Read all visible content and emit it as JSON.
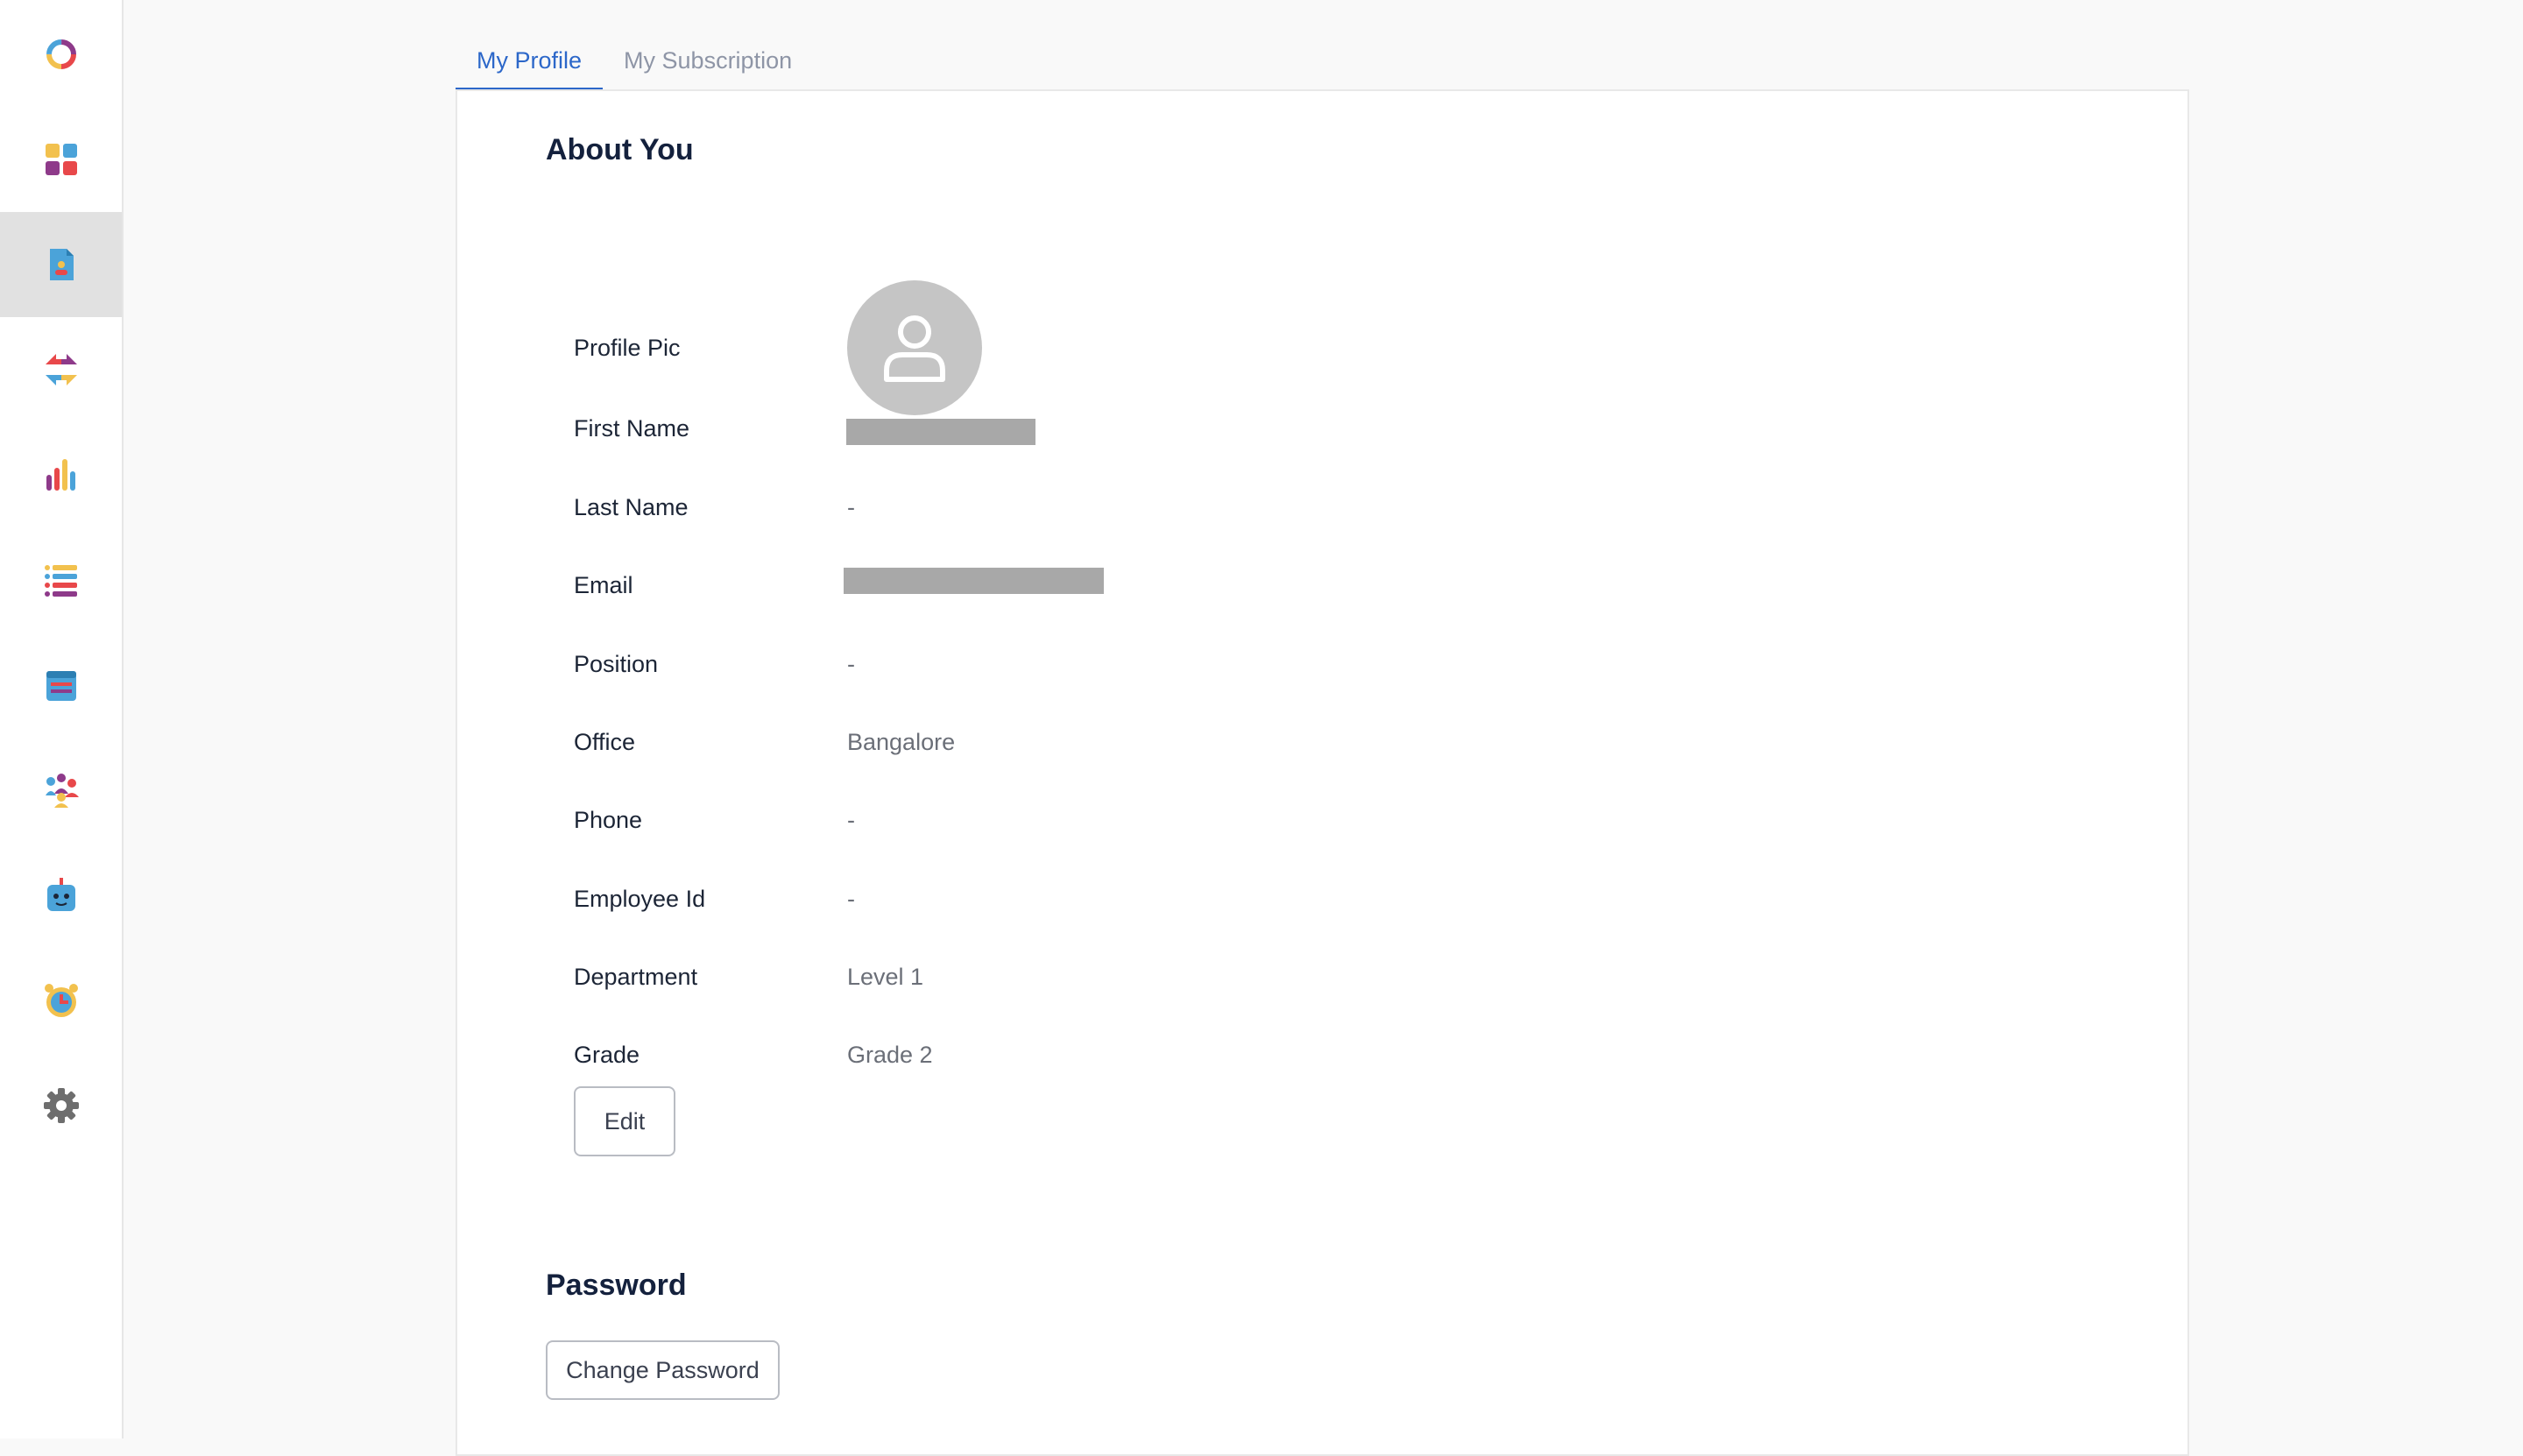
{
  "sidebar": {
    "items": [
      {
        "name": "logo-icon"
      },
      {
        "name": "dashboard-icon"
      },
      {
        "name": "profile-document-icon",
        "active": true
      },
      {
        "name": "transfer-arrows-icon"
      },
      {
        "name": "bar-chart-icon"
      },
      {
        "name": "list-icon"
      },
      {
        "name": "calendar-icon"
      },
      {
        "name": "team-icon"
      },
      {
        "name": "bot-icon"
      },
      {
        "name": "alarm-clock-icon"
      },
      {
        "name": "gear-icon"
      }
    ]
  },
  "tabs": [
    {
      "label": "My Profile",
      "active": true
    },
    {
      "label": "My Subscription",
      "active": false
    }
  ],
  "about": {
    "title": "About You",
    "fields": [
      {
        "label": "Profile Pic",
        "value": ""
      },
      {
        "label": "First Name",
        "value": ""
      },
      {
        "label": "Last Name",
        "value": "-"
      },
      {
        "label": "Email",
        "value": ""
      },
      {
        "label": "Position",
        "value": "-"
      },
      {
        "label": "Office",
        "value": "Bangalore"
      },
      {
        "label": "Phone",
        "value": "-"
      },
      {
        "label": "Employee Id",
        "value": "-"
      },
      {
        "label": "Department",
        "value": "Level 1"
      },
      {
        "label": "Grade",
        "value": "Grade 2"
      }
    ],
    "edit_label": "Edit"
  },
  "password": {
    "title": "Password",
    "change_label": "Change Password"
  },
  "colors": {
    "accent": "#2c67c9",
    "active_sidebar_bg": "#e1e1e1"
  }
}
